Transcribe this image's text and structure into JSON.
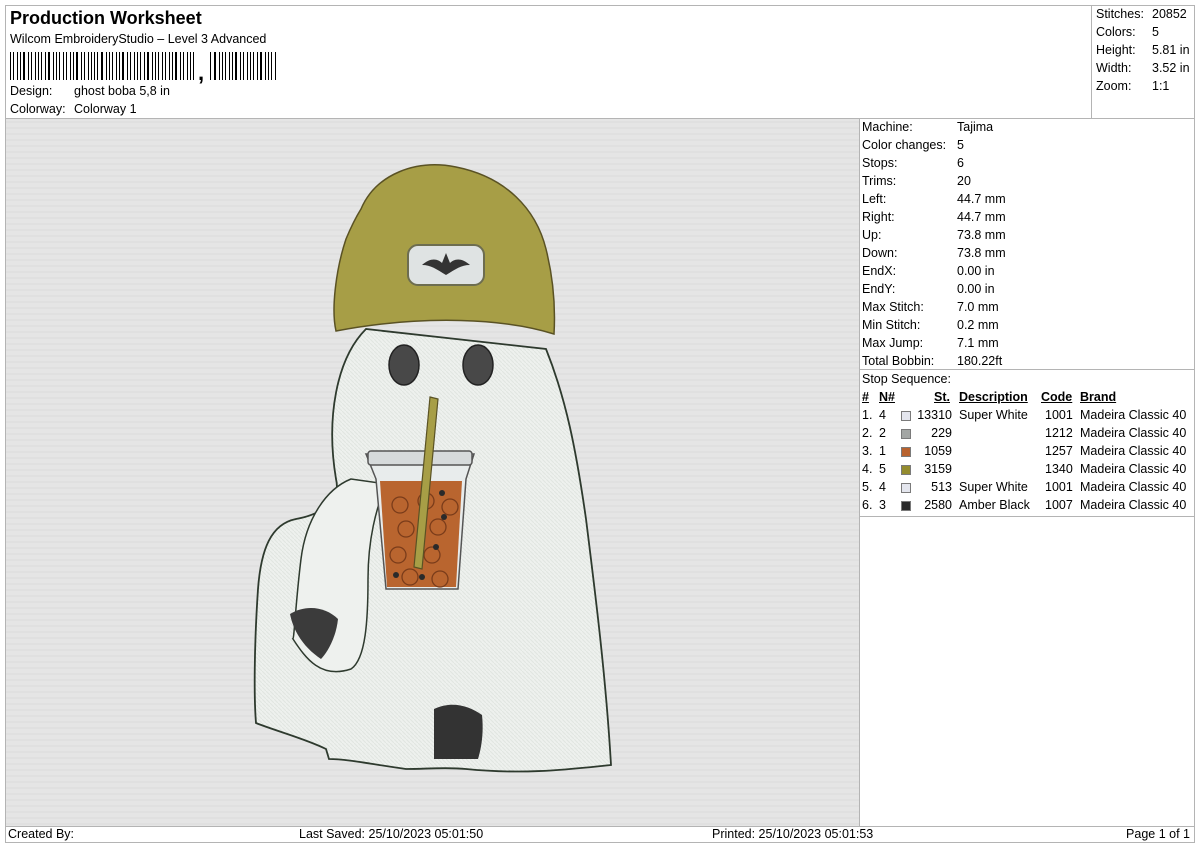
{
  "header": {
    "title": "Production Worksheet",
    "software": "Wilcom EmbroideryStudio – Level 3 Advanced",
    "barcode_mark": ",",
    "design_label": "Design:",
    "design_value": "ghost boba 5,8 in",
    "colorway_label": "Colorway:",
    "colorway_value": "Colorway 1"
  },
  "summary": [
    {
      "label": "Stitches:",
      "value": "20852"
    },
    {
      "label": "Colors:",
      "value": "5"
    },
    {
      "label": "Height:",
      "value": "5.81 in"
    },
    {
      "label": "Width:",
      "value": "3.52 in"
    },
    {
      "label": "Zoom:",
      "value": "1:1"
    }
  ],
  "machine_info": [
    {
      "label": "Machine:",
      "value": "Tajima"
    },
    {
      "label": "Color changes:",
      "value": "5"
    },
    {
      "label": "Stops:",
      "value": "6"
    },
    {
      "label": "Trims:",
      "value": "20"
    },
    {
      "label": "Left:",
      "value": "44.7 mm"
    },
    {
      "label": "Right:",
      "value": "44.7 mm"
    },
    {
      "label": "Up:",
      "value": "73.8 mm"
    },
    {
      "label": "Down:",
      "value": "73.8 mm"
    },
    {
      "label": "EndX:",
      "value": "0.00 in"
    },
    {
      "label": "EndY:",
      "value": "0.00 in"
    },
    {
      "label": "Max Stitch:",
      "value": "7.0 mm"
    },
    {
      "label": "Min Stitch:",
      "value": "0.2 mm"
    },
    {
      "label": "Max Jump:",
      "value": "7.1 mm"
    },
    {
      "label": "Total Bobbin:",
      "value": "180.22ft"
    }
  ],
  "stop_sequence": {
    "title": "Stop Sequence:",
    "headers": {
      "num": "#",
      "n": "N#",
      "st": "St.",
      "desc": "Description",
      "code": "Code",
      "brand": "Brand"
    },
    "rows": [
      {
        "num": "1.",
        "n": "4",
        "color": "#e4e6ee",
        "st": "13310",
        "desc": "Super White",
        "code": "1001",
        "brand": "Madeira Classic 40"
      },
      {
        "num": "2.",
        "n": "2",
        "color": "#a3a6a4",
        "st": "229",
        "desc": "",
        "code": "1212",
        "brand": "Madeira Classic 40"
      },
      {
        "num": "3.",
        "n": "1",
        "color": "#b8622e",
        "st": "1059",
        "desc": "",
        "code": "1257",
        "brand": "Madeira Classic 40"
      },
      {
        "num": "4.",
        "n": "5",
        "color": "#948c2e",
        "st": "3159",
        "desc": "",
        "code": "1340",
        "brand": "Madeira Classic 40"
      },
      {
        "num": "5.",
        "n": "4",
        "color": "#e4e6ee",
        "st": "513",
        "desc": "Super White",
        "code": "1001",
        "brand": "Madeira Classic 40"
      },
      {
        "num": "6.",
        "n": "3",
        "color": "#2a2a2a",
        "st": "2580",
        "desc": "Amber Black",
        "code": "1007",
        "brand": "Madeira Classic 40"
      }
    ]
  },
  "footer": {
    "created_by": "Created By:",
    "last_saved": "Last Saved: 25/10/2023 05:01:50",
    "printed": "Printed: 25/10/2023 05:01:53",
    "page": "Page 1 of 1"
  }
}
